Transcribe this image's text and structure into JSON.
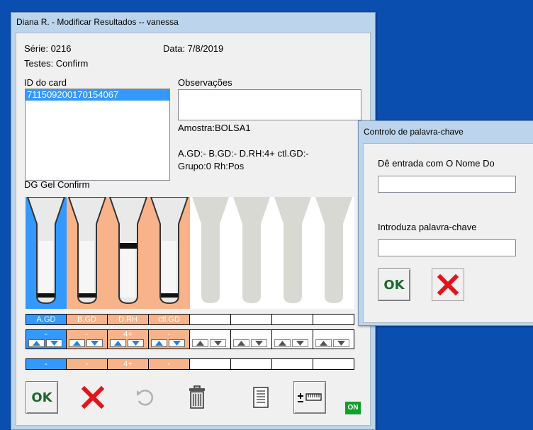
{
  "main_window": {
    "title": "Diana R. - Modificar Resultados -- vanessa",
    "serie": "Série: 0216",
    "data": "Data: 7/8/2019",
    "testes": "Testes: Confirm",
    "card_id_label": "ID do card",
    "card_ids": [
      "711509200170154067"
    ],
    "observacoes_label": "Observações",
    "observacoes_value": "",
    "amostra": "Amostra:BOLSA1",
    "results_line1": "A.GD:-  B.GD:-  D.RH:4+  ctl.GD:-",
    "results_line2": "Grupo:0  Rh:Pos",
    "gel_label": "DG Gel Confirm",
    "columns": [
      {
        "label": "A.GD",
        "value": "-",
        "result": "-",
        "bg": "#3399ff"
      },
      {
        "label": "B.GD",
        "value": "-",
        "result": "-",
        "bg": "#f8b38a"
      },
      {
        "label": "D.RH",
        "value": "4+",
        "result": "4+",
        "bg": "#f8b38a"
      },
      {
        "label": "ctl.GD",
        "value": "-",
        "result": "-",
        "bg": "#f8b38a"
      },
      {
        "label": "",
        "value": "",
        "result": "",
        "bg": "#ffffff"
      },
      {
        "label": "",
        "value": "",
        "result": "",
        "bg": "#ffffff"
      },
      {
        "label": "",
        "value": "",
        "result": "",
        "bg": "#ffffff"
      },
      {
        "label": "",
        "value": "",
        "result": "",
        "bg": "#ffffff"
      }
    ],
    "buttons": {
      "ok_label": "OK",
      "on_badge": "ON"
    }
  },
  "password_dialog": {
    "title": "Controlo de palavra-chave",
    "name_prompt": "Dê entrada com O Nome Do",
    "name_value": "",
    "password_prompt": "Introduza palavra-chave",
    "password_value": "",
    "ok_label": "OK"
  },
  "colors": {
    "desktop": "#0a4fb0",
    "selection": "#3399ff",
    "peach": "#f8b38a",
    "ok_green": "#1a6a2c",
    "cancel_red": "#e0161c"
  }
}
